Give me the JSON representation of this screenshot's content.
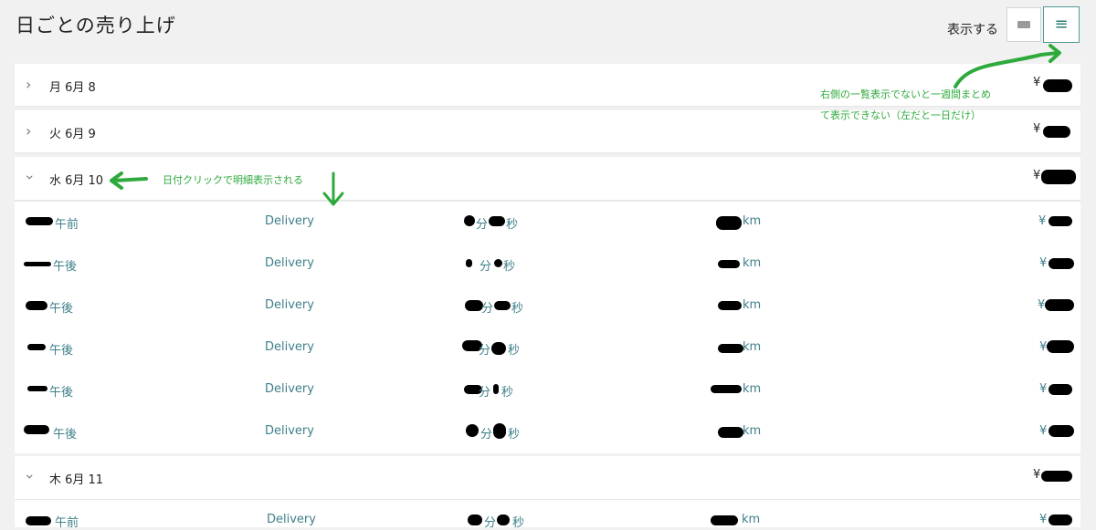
{
  "page": {
    "title": "日ごとの売り上げ"
  },
  "view_toggle": {
    "label": "表示する",
    "compact_icon": "compact-view-icon",
    "list_icon": "list-view-icon"
  },
  "days": [
    {
      "label": "月 6月 8",
      "currency": "¥",
      "expanded": false
    },
    {
      "label": "火 6月 9",
      "currency": "¥",
      "expanded": false
    },
    {
      "label": "水 6月 10",
      "currency": "¥",
      "expanded": true
    },
    {
      "label": "木 6月 11",
      "currency": "¥",
      "expanded": true
    }
  ],
  "trips": [
    {
      "time": "午前",
      "type": "Delivery",
      "min": "分",
      "sec": "秒",
      "dist": "km",
      "currency": "¥"
    },
    {
      "time": "午後",
      "type": "Delivery",
      "min": "分",
      "sec": "秒",
      "dist": "km",
      "currency": "¥"
    },
    {
      "time": "午後",
      "type": "Delivery",
      "min": "分",
      "sec": "秒",
      "dist": "km",
      "currency": "¥"
    },
    {
      "time": "午後",
      "type": "Delivery",
      "min": "分",
      "sec": "秒",
      "dist": "km",
      "currency": "¥"
    },
    {
      "time": "午後",
      "type": "Delivery",
      "min": "分",
      "sec": "秒",
      "dist": "km",
      "currency": "¥"
    },
    {
      "time": "午後",
      "type": "Delivery",
      "min": "分",
      "sec": "秒",
      "dist": "km",
      "currency": "¥"
    },
    {
      "time": "午前",
      "type": "Delivery",
      "min": "分",
      "sec": "秒",
      "dist": "km",
      "currency": "¥"
    }
  ],
  "annotations": {
    "list_note_line1": "右側の一覧表示でないと一週間まとめ",
    "list_note_line2": "て表示できない（左だと一日だけ）",
    "date_note": "日付クリックで明細表示される"
  },
  "colors": {
    "accent": "#2e7d77",
    "link": "#3f7f8a",
    "annotation": "#2eaa3c"
  }
}
